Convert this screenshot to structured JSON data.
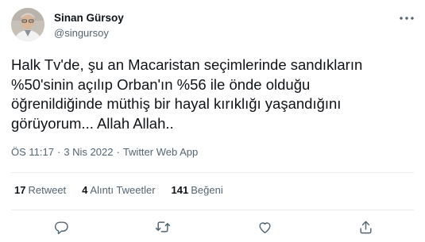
{
  "user": {
    "display_name": "Sinan Gürsoy",
    "handle": "@singursoy"
  },
  "tweet": {
    "lines": [
      "Halk Tv'de, şu an Macaristan seçimlerinde sandıkların",
      "%50'sinin açılıp Orban'ın %56 ile önde olduğu",
      "öğrenildiğinde müthiş bir hayal kırıklığı yaşandığını",
      "görüyorum... Allah Allah.."
    ],
    "time": "ÖS 11:17",
    "date": "3 Nis 2022",
    "separator": "·",
    "source": "Twitter Web App"
  },
  "stats": {
    "retweets_count": "17",
    "retweets_label": "Retweet",
    "quotes_count": "4",
    "quotes_label": "Alıntı Tweetler",
    "likes_count": "141",
    "likes_label": "Beğeni"
  },
  "icons": {
    "more": "more-horizontal-icon",
    "reply": "reply-icon",
    "retweet": "retweet-icon",
    "like": "heart-icon",
    "share": "share-icon"
  },
  "colors": {
    "text_primary": "#0f1419",
    "text_secondary": "#536471",
    "divider": "#e6ecf0"
  }
}
